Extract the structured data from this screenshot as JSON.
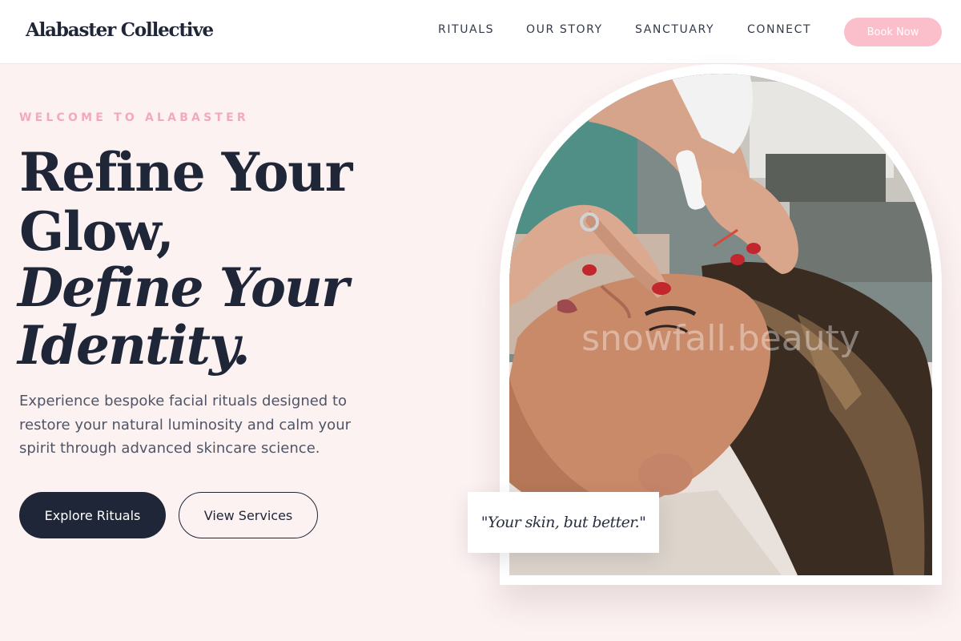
{
  "header": {
    "logo": "Alabaster Collective",
    "nav": [
      "RITUALS",
      "OUR STORY",
      "SANCTUARY",
      "CONNECT"
    ],
    "book_label": "Book Now"
  },
  "hero": {
    "eyebrow": "WELCOME TO ALABASTER",
    "headline": [
      "Refine Your",
      "Glow,",
      "Define Your",
      "Identity."
    ],
    "intro": "Experience bespoke facial rituals designed to restore your natural luminosity and calm your spirit through advanced skincare science.",
    "primary_cta": "Explore Rituals",
    "secondary_cta": "View Services"
  },
  "image": {
    "watermark": "snowfall.beauty",
    "quote": "\"Your skin, but better.\""
  },
  "colors": {
    "background": "#fdf2f2",
    "navy": "#1e2638",
    "accent_pink": "#fbbfcc",
    "eyebrow_pink": "#f4a9bb"
  }
}
